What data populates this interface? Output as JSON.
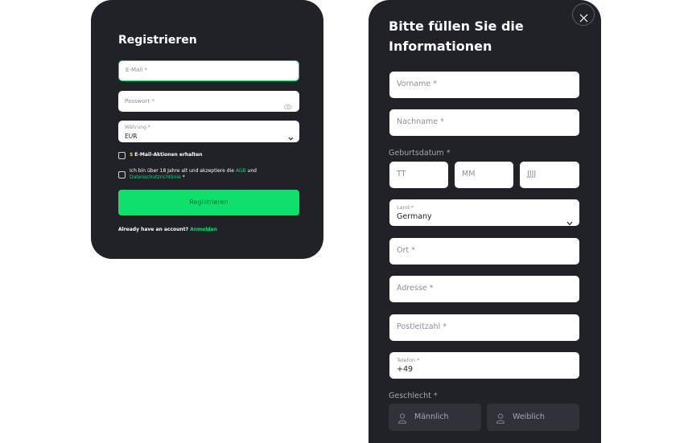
{
  "registration": {
    "title": "Registrieren",
    "email_placeholder": "E-Mail *",
    "password_placeholder": "Passwort *",
    "currency_label": "Währung *",
    "currency_value": "EUR",
    "promo_prefix": "$",
    "promo_label": "E-Mail-Aktionen erhalten",
    "terms_text_1": "Ich bin über 18 Jahre alt und akzeptiere die",
    "terms_link_agb": "AGB",
    "terms_and": "und",
    "terms_link_privacy": "Datenschutzrichtlinie",
    "terms_required": "*",
    "submit_label": "Registrieren",
    "login_prompt": "Already have an account?",
    "login_link": "Anmelden"
  },
  "info_form": {
    "title": "Bitte füllen Sie die Informationen",
    "first_name_placeholder": "Vorname *",
    "last_name_placeholder": "Nachname *",
    "birthdate_label": "Geburtsdatum *",
    "day_placeholder": "TT",
    "month_placeholder": "MM",
    "year_placeholder": "JJJJ",
    "country_label": "Land *",
    "country_value": "Germany",
    "city_placeholder": "Ort *",
    "address_placeholder": "Adresse *",
    "zip_placeholder": "Postleitzahl *",
    "phone_label": "Telefon *",
    "phone_value": "+49",
    "gender_label": "Geschlecht *",
    "gender_male": "Männlich",
    "gender_female": "Weiblich"
  },
  "colors": {
    "panel": "#202228",
    "accent_green": "#0ee06b",
    "field_bg": "#ffffff",
    "gender_button_bg": "#2f3238"
  }
}
